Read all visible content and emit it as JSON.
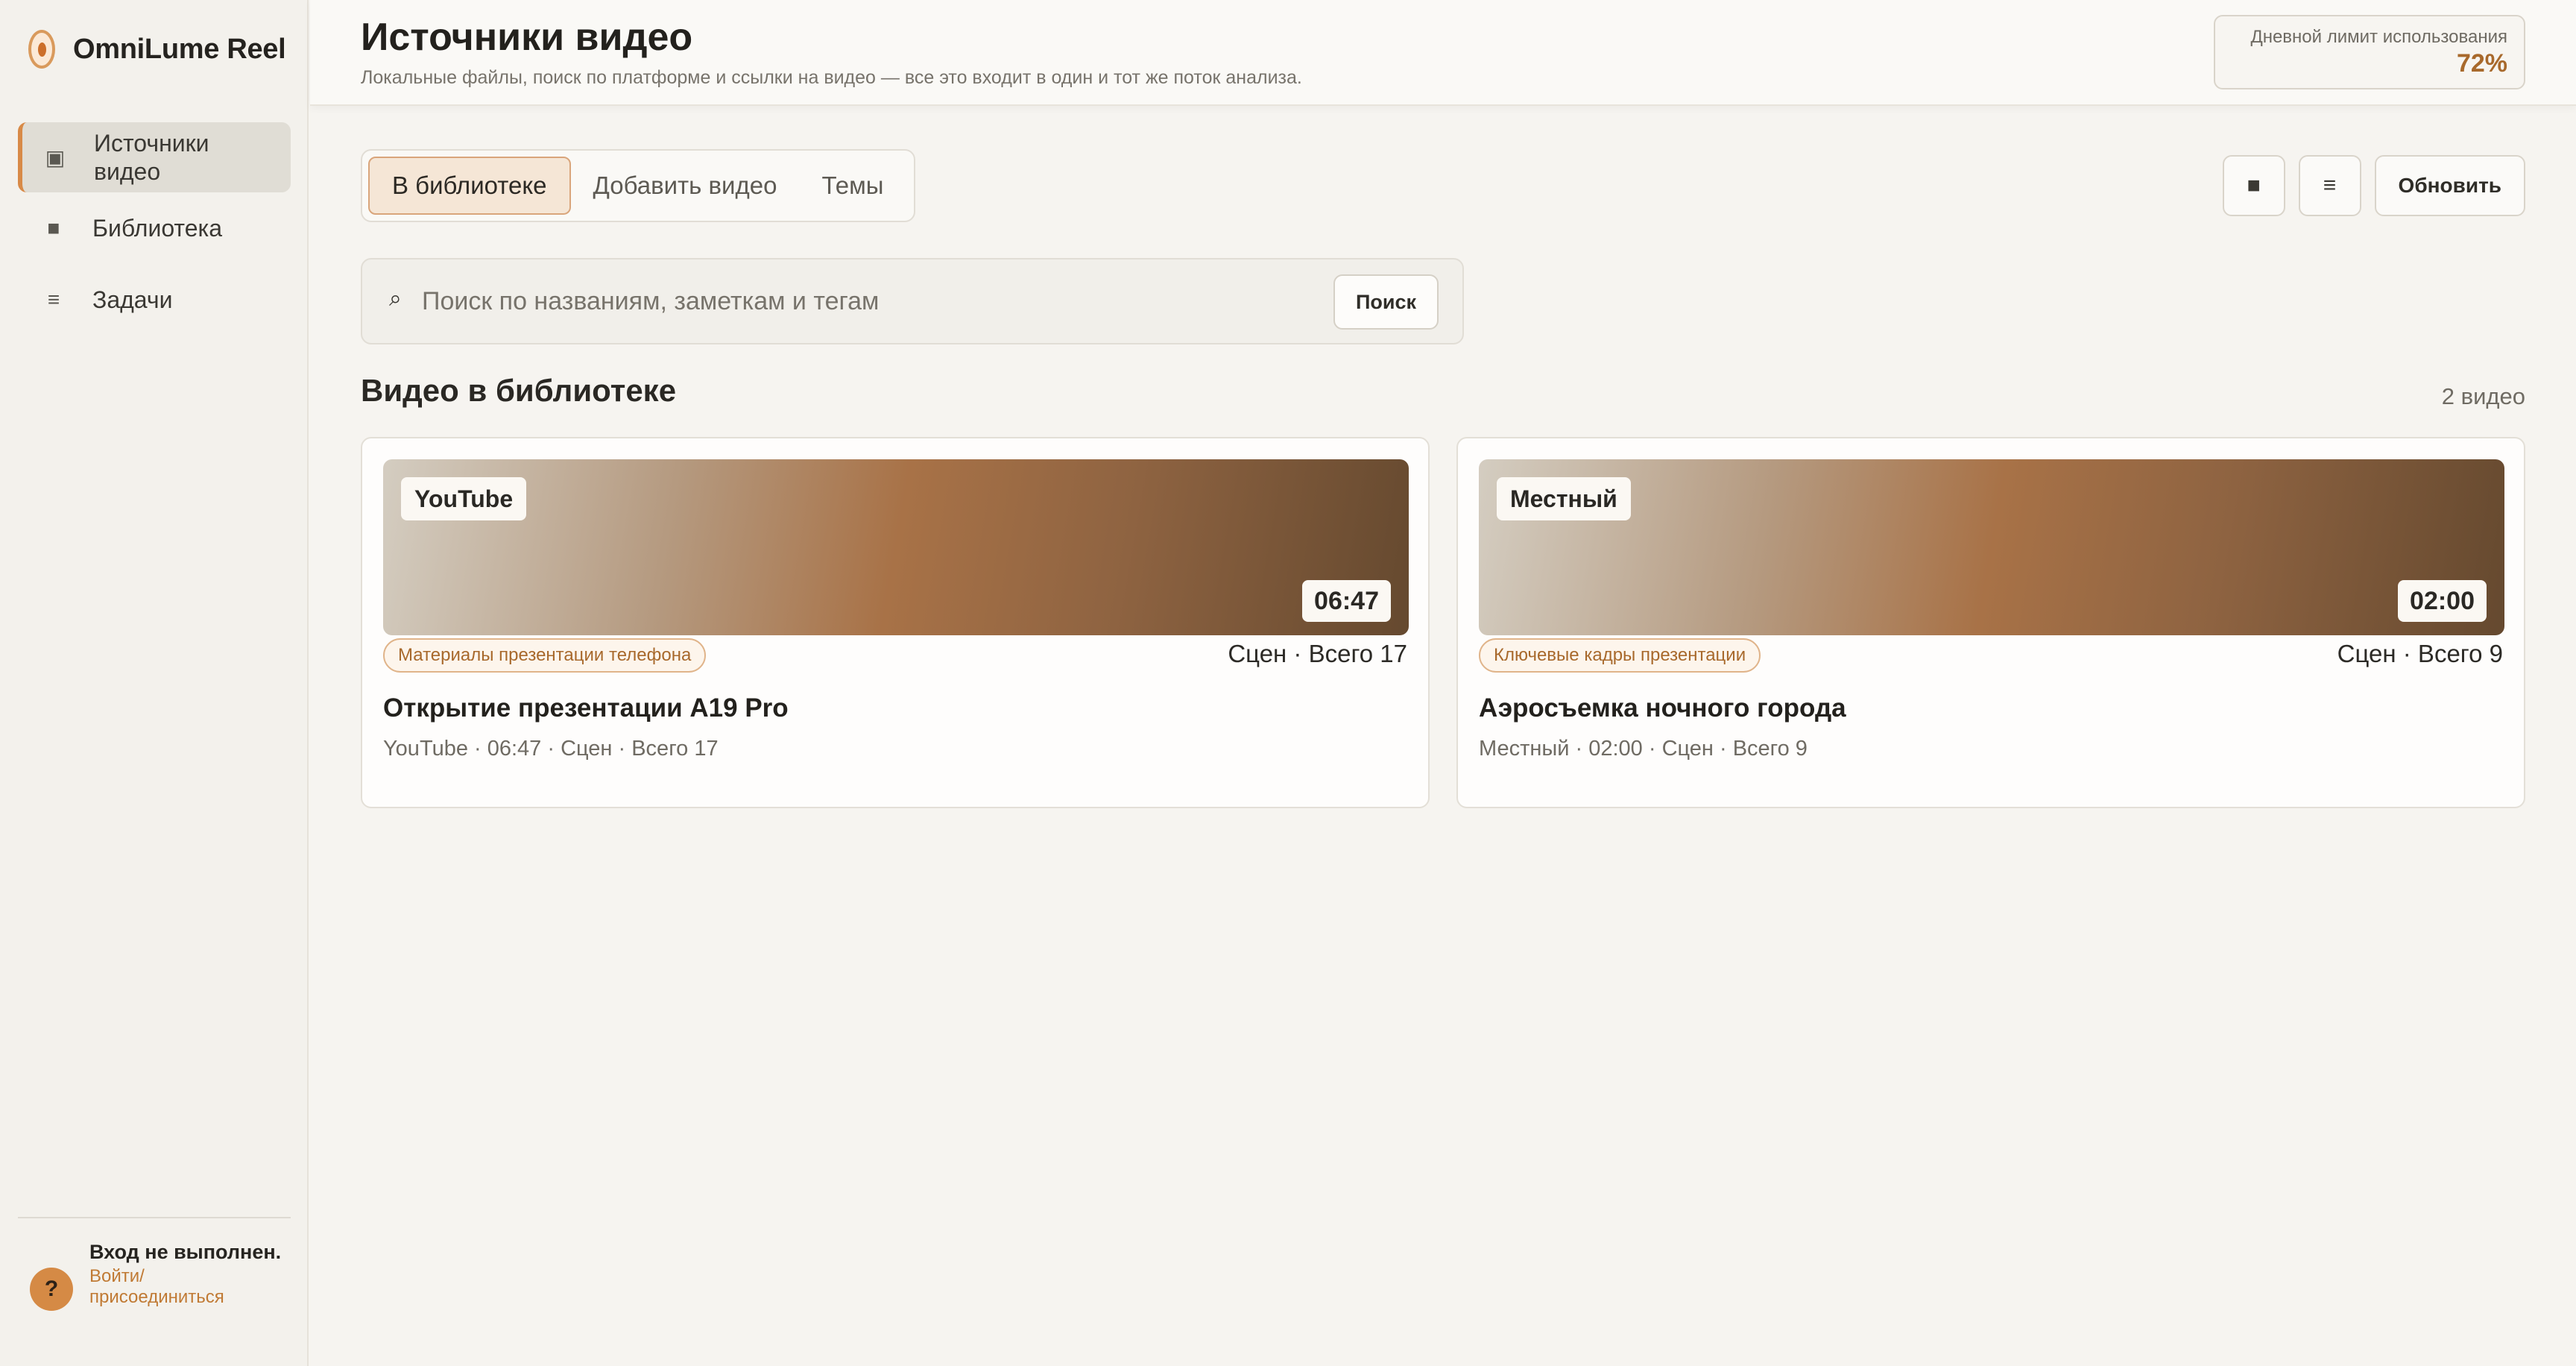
{
  "app": {
    "name": "OmniLume Reel"
  },
  "sidebar": {
    "items": [
      {
        "icon": "square-media-icon",
        "glyph": "▣",
        "label": "Источники видео",
        "active": true
      },
      {
        "icon": "library-icon",
        "glyph": "■",
        "label": "Библиотека",
        "active": false
      },
      {
        "icon": "tasks-icon",
        "glyph": "≡",
        "label": "Задачи",
        "active": false
      }
    ],
    "login": {
      "avatar": "?",
      "title": "Вход не выполнен.",
      "link": "Войти/ присоединиться"
    }
  },
  "header": {
    "title": "Источники видео",
    "subtitle": "Локальные файлы, поиск по платформе и ссылки на видео — все это входит в один и тот же поток анализа.",
    "limit_label": "Дневной лимит использования",
    "limit_value": "72%"
  },
  "tabs": [
    {
      "label": "В библиотеке",
      "active": true
    },
    {
      "label": "Добавить видео",
      "active": false
    },
    {
      "label": "Темы",
      "active": false
    }
  ],
  "toolbar": {
    "grid_glyph": "■",
    "list_glyph": "≡",
    "refresh_label": "Обновить"
  },
  "search": {
    "placeholder": "Поиск по названиям, заметкам и тегам",
    "value": "",
    "button_label": "Поиск",
    "icon_glyph": "⌕"
  },
  "section": {
    "title": "Видео в библиотеке",
    "count": "2 видео"
  },
  "videos": [
    {
      "source": "YouTube",
      "duration": "06:47",
      "tag": "Материалы презентации телефона",
      "scenes": "Сцен · Всего 17",
      "title": "Открытие презентации A19 Pro",
      "meta": "YouTube · 06:47 · Сцен · Всего 17"
    },
    {
      "source": "Местный",
      "duration": "02:00",
      "tag": "Ключевые кадры презентации",
      "scenes": "Сцен · Всего 9",
      "title": "Аэросъемка ночного города",
      "meta": "Местный · 02:00 · Сцен · Всего 9"
    }
  ],
  "colors": {
    "accent": "#d88a47",
    "accent_text": "#a8692c",
    "background": "#f6f4f0"
  }
}
